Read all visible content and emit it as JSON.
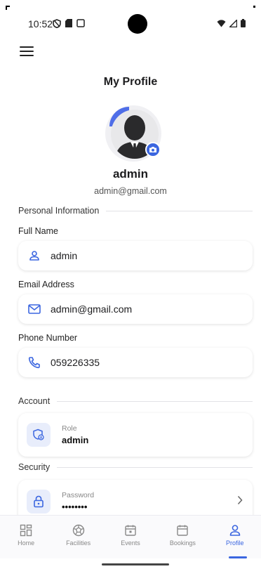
{
  "status_bar": {
    "time": "10:52"
  },
  "header": {
    "title": "My Profile"
  },
  "profile": {
    "name": "admin",
    "email": "admin@gmail.com"
  },
  "sections": {
    "personal": "Personal Information",
    "account": "Account",
    "security": "Security"
  },
  "fields": {
    "full_name": {
      "label": "Full Name",
      "value": "admin"
    },
    "email": {
      "label": "Email Address",
      "value": "admin@gmail.com"
    },
    "phone": {
      "label": "Phone Number",
      "value": "059226335"
    }
  },
  "account": {
    "role_label": "Role",
    "role_value": "admin"
  },
  "security": {
    "password_label": "Password",
    "password_value": "••••••••"
  },
  "nav": [
    {
      "label": "Home",
      "icon": "dashboard-icon"
    },
    {
      "label": "Facilities",
      "icon": "sports-ball-icon"
    },
    {
      "label": "Events",
      "icon": "event-calendar-icon"
    },
    {
      "label": "Bookings",
      "icon": "calendar-icon"
    },
    {
      "label": "Profile",
      "icon": "person-icon",
      "active": true
    }
  ],
  "colors": {
    "accent": "#3b66e0",
    "icon_bg": "#e8edfb"
  }
}
